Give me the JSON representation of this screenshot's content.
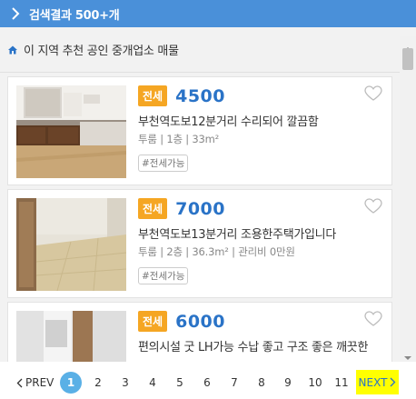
{
  "header": {
    "title": "검색결과 500+개"
  },
  "section": {
    "title": "이 지역 추천 공인 중개업소 매물"
  },
  "listings": [
    {
      "badge": "전세",
      "price": "4500",
      "description": "부천역도보12분거리 수리되어 깔끔함",
      "meta": "투룸 | 1층 | 33m²",
      "tag": "#전세가능"
    },
    {
      "badge": "전세",
      "price": "7000",
      "description": "부천역도보13분거리 조용한주택가입니다",
      "meta": "투룸 | 2층 | 36.3m² | 관리비 0만원",
      "tag": "#전세가능"
    },
    {
      "badge": "전세",
      "price": "6000",
      "description": "편의시설 굿 LH가능 수납 좋고 구조 좋은 깨끗한",
      "meta": "",
      "tag": ""
    }
  ],
  "pagination": {
    "prev_label": "PREV",
    "next_label": "NEXT",
    "pages": [
      "1",
      "2",
      "3",
      "4",
      "5",
      "6",
      "7",
      "8",
      "9",
      "10",
      "11"
    ],
    "current": "1"
  },
  "colors": {
    "header_bg": "#4a90d9",
    "badge": "#f5a623",
    "price": "#2a73c7",
    "active_page": "#5ab0e6",
    "next_highlight": "#ffff00"
  }
}
